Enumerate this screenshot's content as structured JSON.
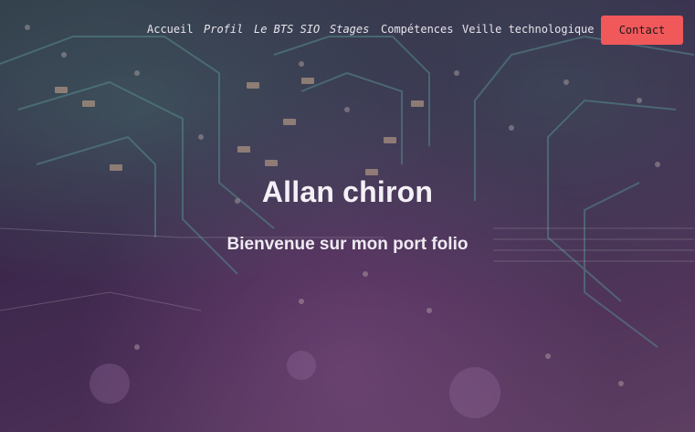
{
  "nav": {
    "items": [
      {
        "label": "Accueil"
      },
      {
        "label": "Profil"
      },
      {
        "label": "Le BTS SIO"
      },
      {
        "label": "Stages"
      },
      {
        "label": "Compétences"
      },
      {
        "label": "Veille technologique"
      }
    ],
    "contact_label": "Contact"
  },
  "hero": {
    "title": "Allan chiron",
    "subtitle": "Bienvenue sur mon port folio"
  },
  "colors": {
    "contact_button": "#f0585a",
    "text": "#f4f1f6"
  }
}
